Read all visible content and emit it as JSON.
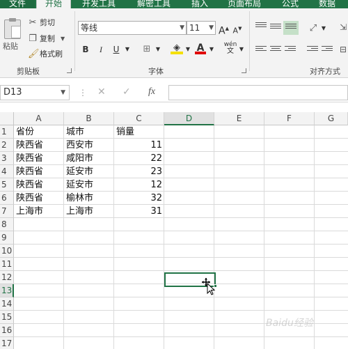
{
  "ribbon_tabs": [
    "文件",
    "开始",
    "开发工具",
    "解密工具",
    "插入",
    "页面布局",
    "公式",
    "数据"
  ],
  "clipboard": {
    "paste_label": "粘贴",
    "cut_label": "剪切",
    "copy_label": "复制",
    "format_painter_label": "格式刷",
    "group_label": "剪贴板"
  },
  "font": {
    "name": "等线",
    "size": "11",
    "group_label": "字体",
    "bold": "B",
    "italic": "I",
    "underline": "U",
    "grow": "A",
    "shrink": "A",
    "phonetic": "wén"
  },
  "alignment": {
    "group_label": "对齐方式"
  },
  "formula_bar": {
    "name_box": "D13",
    "fx": "fx",
    "cancel": "✕",
    "enter": "✓",
    "value": ""
  },
  "columns": [
    "A",
    "B",
    "C",
    "D",
    "E",
    "F",
    "G"
  ],
  "selected_column": "D",
  "rows": [
    "1",
    "2",
    "3",
    "4",
    "5",
    "6",
    "7",
    "8",
    "9",
    "10",
    "11",
    "12",
    "13",
    "14",
    "15",
    "16",
    "17"
  ],
  "selected_row": "13",
  "table": {
    "headers": [
      "省份",
      "城市",
      "销量"
    ],
    "data": [
      [
        "陕西省",
        "西安市",
        "11"
      ],
      [
        "陕西省",
        "咸阳市",
        "22"
      ],
      [
        "陕西省",
        "延安市",
        "23"
      ],
      [
        "陕西省",
        "延安市",
        "12"
      ],
      [
        "陕西省",
        "榆林市",
        "32"
      ],
      [
        "上海市",
        "上海市",
        "31"
      ]
    ]
  },
  "watermark": "Baidu经验",
  "colors": {
    "accent": "#217346"
  }
}
